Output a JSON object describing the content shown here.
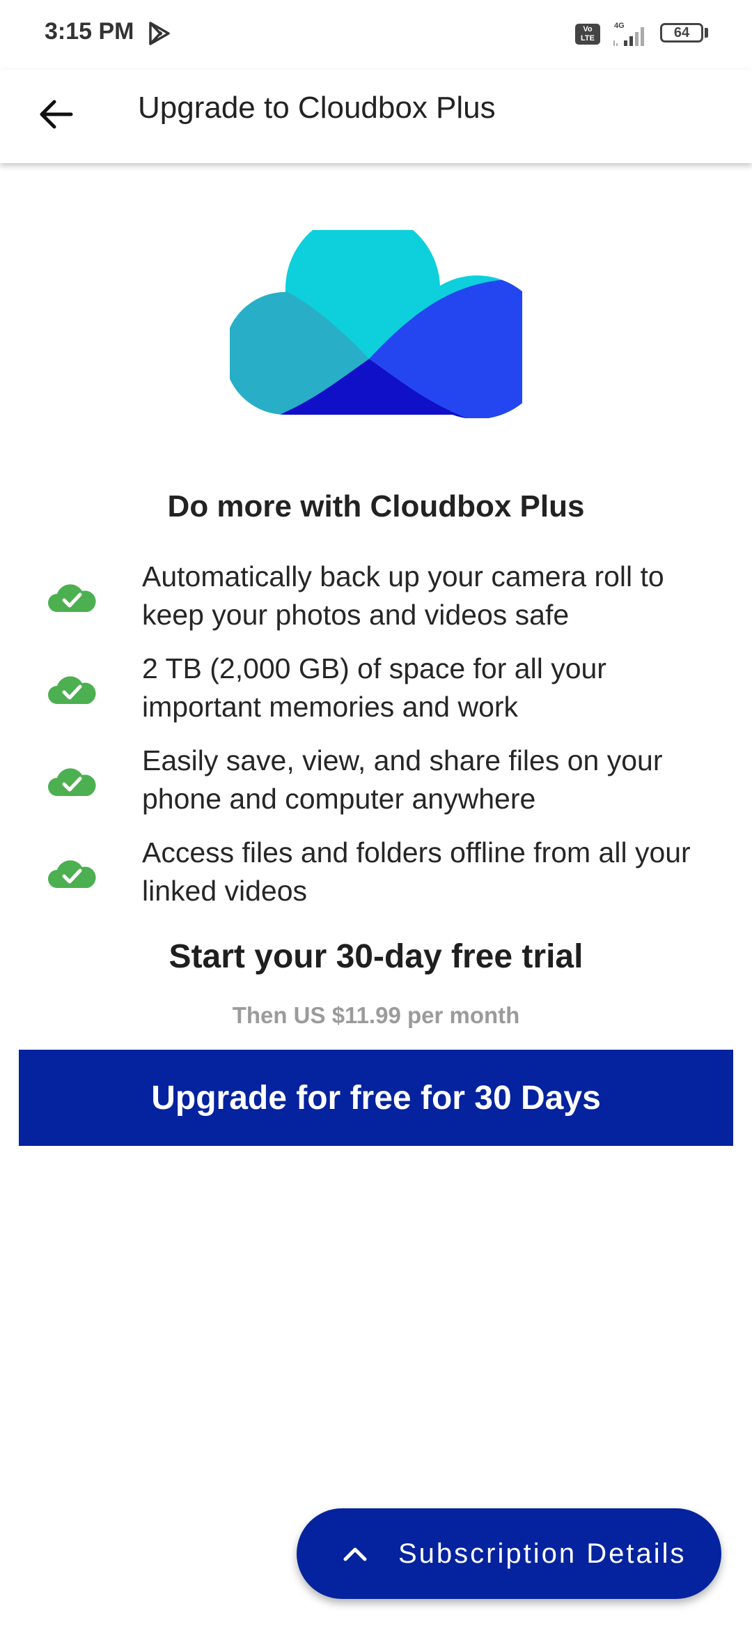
{
  "status_bar": {
    "time": "3:15 PM",
    "network": "4G",
    "volte": "Vo LTE",
    "battery": "64",
    "icons": [
      "play-store-icon",
      "volte-icon",
      "signal-icon",
      "battery-icon"
    ]
  },
  "app_bar": {
    "title": "Upgrade to Cloudbox Plus",
    "back_icon": "arrow-left-icon"
  },
  "hero": {
    "icon": "cloud-logo"
  },
  "headline": "Do more with Cloudbox Plus",
  "features": [
    {
      "icon": "cloud-check-icon",
      "text": "Automatically back up your camera roll to keep your photos and videos safe"
    },
    {
      "icon": "cloud-check-icon",
      "text": "2 TB (2,000 GB) of space for all your important memories and work"
    },
    {
      "icon": "cloud-check-icon",
      "text": "Easily save, view, and share files on your phone and computer anywhere"
    },
    {
      "icon": "cloud-check-icon",
      "text": "Access files and folders offline from all your linked videos"
    }
  ],
  "trial": {
    "title": "Start your 30-day free trial",
    "price_note": "Then US $11.99 per month"
  },
  "upgrade_button": {
    "label": "Upgrade for free for 30 Days"
  },
  "subscription_button": {
    "label": "Subscription Details",
    "icon": "chevron-up-icon"
  },
  "colors": {
    "primary": "#05239e",
    "check_green": "#4caf50",
    "cloud_cyan": "#0ecfdc",
    "cloud_teal": "#29aec7",
    "cloud_blue": "#2446f0",
    "cloud_navy": "#1010c8",
    "muted_text": "#9b9b9b"
  }
}
